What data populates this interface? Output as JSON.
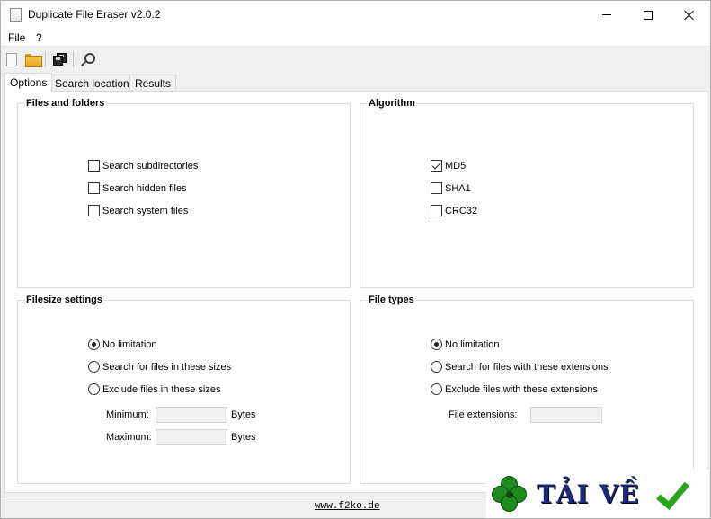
{
  "window": {
    "title": "Duplicate File Eraser v2.0.2"
  },
  "menubar": {
    "items": [
      {
        "label": "File"
      },
      {
        "label": "?"
      }
    ]
  },
  "toolbar": {
    "buttons": [
      {
        "icon": "new-file-icon"
      },
      {
        "icon": "open-folder-icon"
      },
      {
        "icon": "save-icon"
      },
      {
        "icon": "search-icon"
      }
    ]
  },
  "tabs": [
    {
      "label": "Options",
      "active": true
    },
    {
      "label": "Search locations",
      "active": false
    },
    {
      "label": "Results",
      "active": false
    }
  ],
  "files_and_folders": {
    "title": "Files and folders",
    "options": [
      {
        "label": "Search subdirectories",
        "checked": false
      },
      {
        "label": "Search hidden files",
        "checked": false
      },
      {
        "label": "Search system files",
        "checked": false
      }
    ]
  },
  "algorithm": {
    "title": "Algorithm",
    "options": [
      {
        "label": "MD5",
        "checked": true
      },
      {
        "label": "SHA1",
        "checked": false
      },
      {
        "label": "CRC32",
        "checked": false
      }
    ]
  },
  "filesize_settings": {
    "title": "Filesize settings",
    "options": [
      {
        "label": "No limitation",
        "selected": true
      },
      {
        "label": "Search for files in these sizes",
        "selected": false
      },
      {
        "label": "Exclude files in these sizes",
        "selected": false
      }
    ],
    "minimum_label": "Minimum:",
    "maximum_label": "Maximum:",
    "unit": "Bytes",
    "minimum_value": "",
    "maximum_value": ""
  },
  "file_types": {
    "title": "File types",
    "options": [
      {
        "label": "No limitation",
        "selected": true
      },
      {
        "label": "Search for files with these extensions",
        "selected": false
      },
      {
        "label": "Exclude files with these extensions",
        "selected": false
      }
    ],
    "extensions_label": "File extensions:",
    "extensions_value": ""
  },
  "statusbar": {
    "link": "www.f2ko.de"
  },
  "watermark": {
    "text": "TẢI VỀ"
  }
}
